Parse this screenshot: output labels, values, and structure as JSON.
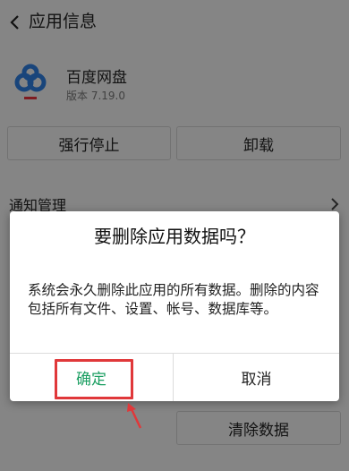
{
  "header": {
    "title": "应用信息"
  },
  "app": {
    "name": "百度网盘",
    "version": "版本 7.19.0"
  },
  "actions": {
    "force_stop": "强行停止",
    "uninstall": "卸载",
    "clear_data": "清除数据"
  },
  "sections": {
    "notification": "通知管理"
  },
  "dialog": {
    "title": "要删除应用数据吗？",
    "message": "系统会永久删除此应用的所有数据。删除的内容包括所有文件、设置、帐号、数据库等。",
    "confirm": "确定",
    "cancel": "取消"
  },
  "colors": {
    "confirm_text": "#1a9e61",
    "annotation": "#e0383a",
    "logo_blue": "#2f7ee0",
    "logo_red": "#e5323b"
  },
  "icons": {
    "back": "chevron-left-icon",
    "section": "chevron-right-icon",
    "app": "baidu-netdisk-logo",
    "annotation": "arrow-up-icon"
  }
}
